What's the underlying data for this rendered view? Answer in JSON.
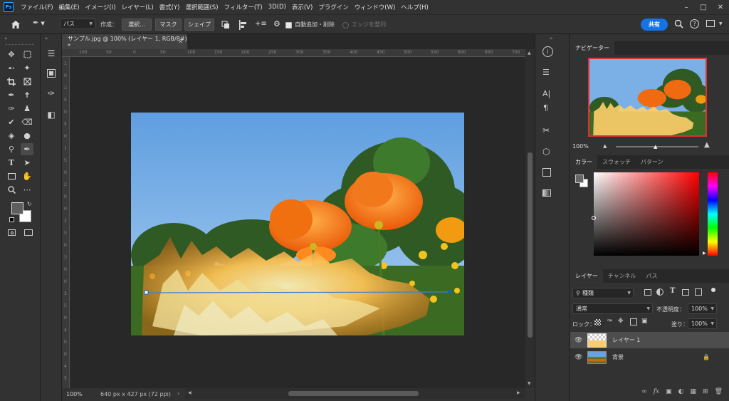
{
  "menu": {
    "logo": "Ps",
    "items": [
      "ファイル(F)",
      "編集(E)",
      "イメージ(I)",
      "レイヤー(L)",
      "書式(Y)",
      "選択範囲(S)",
      "フィルター(T)",
      "3D(D)",
      "表示(V)",
      "プラグイン",
      "ウィンドウ(W)",
      "ヘルプ(H)"
    ]
  },
  "options": {
    "mode_select": "パス",
    "create_label": "作成：",
    "select_btn": "選択...",
    "mask_btn": "マスク",
    "shape_btn": "シェイプ",
    "auto_add_label": "自動追加・削除",
    "align_edges_label": "エッジを整列",
    "share_btn": "共有"
  },
  "document": {
    "tab_title": "サンプル.jpg @ 100% (レイヤー 1, RGB/8#) *",
    "zoom": "100%",
    "info": "640 px x 427 px (72 ppi)",
    "ruler_top": [
      "100",
      "50",
      "0",
      "50",
      "100",
      "150",
      "200",
      "250",
      "300",
      "350",
      "400",
      "450",
      "500",
      "550",
      "600",
      "650",
      "700"
    ],
    "ruler_left": [
      "1",
      "0",
      "1",
      "5",
      "0",
      "5",
      "0",
      "1",
      "5",
      "0",
      "2",
      "0",
      "0",
      "2",
      "5",
      "0",
      "3",
      "0",
      "0",
      "3",
      "5",
      "0",
      "4",
      "0",
      "0",
      "4",
      "5"
    ]
  },
  "navigator": {
    "tab": "ナビゲーター",
    "zoom": "100%"
  },
  "color": {
    "tabs": [
      "カラー",
      "スウォッチ",
      "パターン"
    ],
    "hue_color": "#ff0000"
  },
  "layers": {
    "tabs": [
      "レイヤー",
      "チャンネル",
      "パス"
    ],
    "filter_select": "種類",
    "blend_select": "通常",
    "opacity_label": "不透明度：",
    "opacity_value": "100%",
    "lock_label": "ロック：",
    "fill_label": "塗り：",
    "fill_value": "100%",
    "items": [
      {
        "name": "レイヤー 1",
        "selected": true
      },
      {
        "name": "背景",
        "selected": false
      }
    ]
  },
  "colors": {
    "accent": "#1473e6",
    "panel_bg": "#323232",
    "canvas_bg": "#282828"
  }
}
